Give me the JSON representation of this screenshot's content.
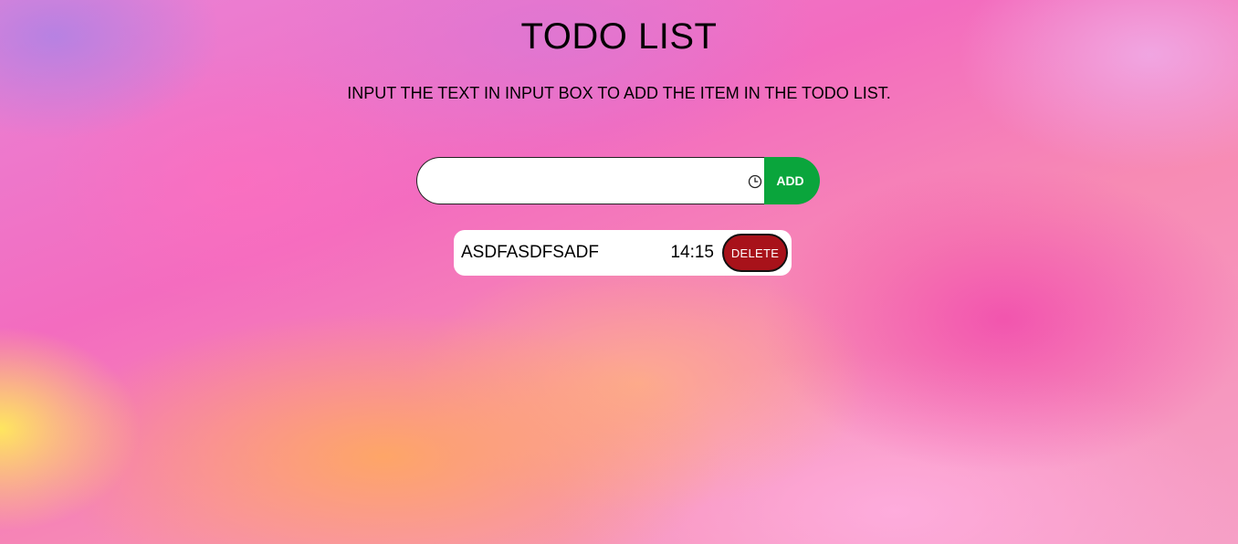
{
  "header": {
    "title": "TODO LIST",
    "subtitle": "INPUT THE TEXT IN INPUT BOX TO ADD THE ITEM IN THE TODO LIST."
  },
  "form": {
    "input_value": "",
    "input_placeholder": "",
    "time_icon": "clock-icon",
    "add_label": "ADD"
  },
  "todos": [
    {
      "text": "ASDFASDFSADF",
      "time": "14:15",
      "delete_label": "DELETE"
    }
  ],
  "colors": {
    "add_button": "#0aa53c",
    "delete_button": "#a8121a",
    "background_accent": "#f27ac6"
  }
}
